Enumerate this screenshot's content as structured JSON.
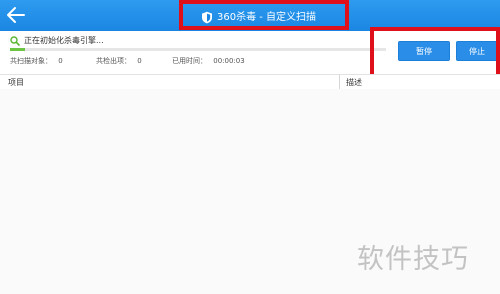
{
  "app": {
    "title": "360杀毒 - 自定义扫描"
  },
  "scan": {
    "status_text": "正在初始化杀毒引擎...",
    "progress_fraction": 0.04,
    "stats": {
      "scanned_label": "共扫描对象：",
      "scanned_value": "0",
      "found_label": "共检出项：",
      "found_value": "0",
      "elapsed_label": "已用时间：",
      "elapsed_value": "00:00:03"
    }
  },
  "buttons": {
    "pause": "暂停",
    "stop": "停止"
  },
  "table": {
    "columns": [
      "项目",
      "描述"
    ]
  },
  "watermark": "软件技巧",
  "colors": {
    "titlebar": "#1a86e2",
    "button": "#2a8ee8",
    "progress": "#6cc644",
    "annotation": "#e0101b"
  },
  "icons": [
    "back-arrow-icon",
    "shield-icon",
    "search-icon"
  ]
}
